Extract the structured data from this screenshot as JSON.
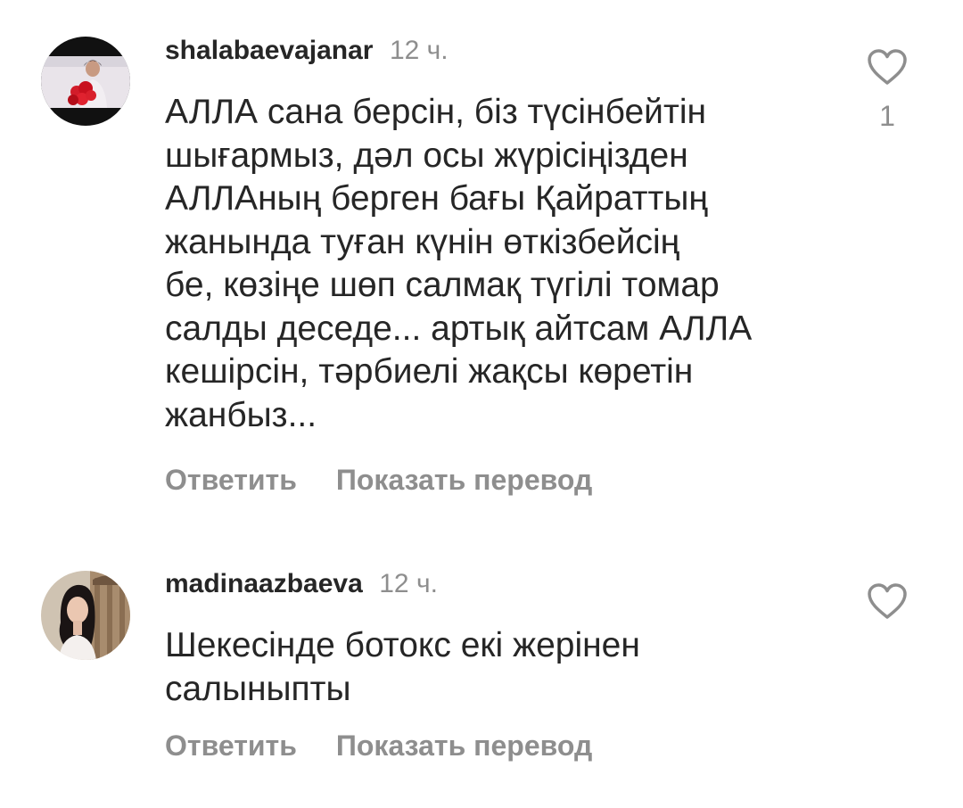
{
  "comments": [
    {
      "username": "shalabaevajanar",
      "time": "12 ч.",
      "text": "АЛЛА сана берсін, біз түсінбейтін\nшығармыз, дәл осы жүрісіңізден\nАЛЛАның берген бағы Қайраттың\nжанында туған күнін өткізбейсің\nбе, көзіңе шөп салмақ түгілі томар\nсалды деседе... артық айтсам АЛЛА\nкешірсін, тәрбиелі жақсы көретін\nжанбыз...",
      "reply_label": "Ответить",
      "translate_label": "Показать перевод",
      "likes": "1",
      "like_icon": "heart-outline-icon"
    },
    {
      "username": "madinaazbaeva",
      "time": "12 ч.",
      "text": "Шекесінде ботокс екі жерінен\nсалыныпты",
      "reply_label": "Ответить",
      "translate_label": "Показать перевод",
      "like_icon": "heart-outline-icon"
    }
  ],
  "colors": {
    "text": "#262626",
    "secondary": "#8e8e8e",
    "background": "#ffffff"
  }
}
